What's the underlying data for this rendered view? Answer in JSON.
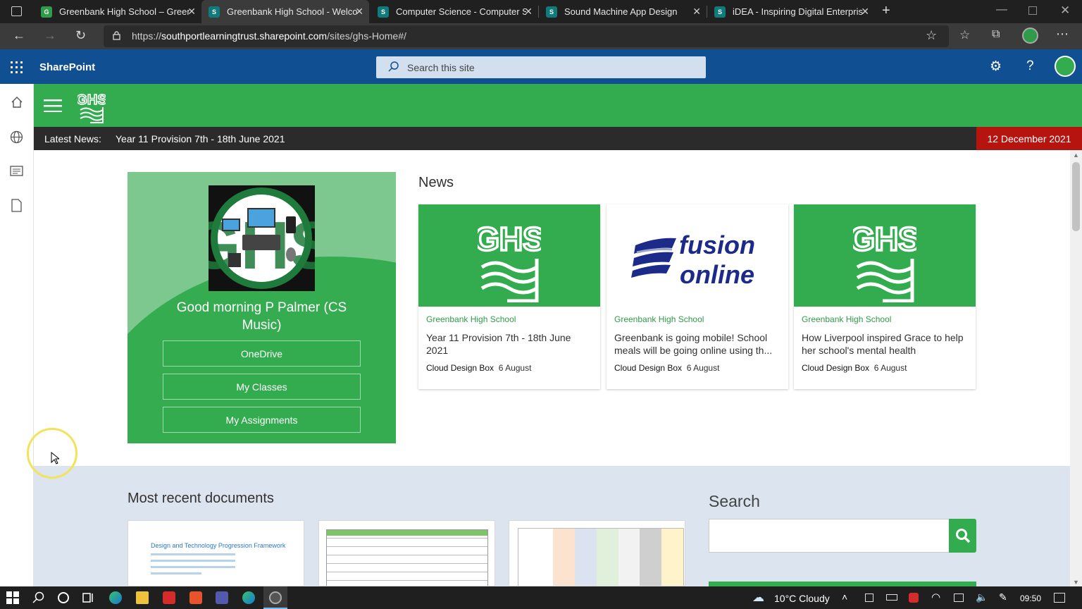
{
  "browser": {
    "tabs": [
      {
        "title": "Greenbank High School – Greenbank",
        "fav_color": "#2f9c4a",
        "fav_text": "G"
      },
      {
        "title": "Greenbank High School - Welcome",
        "fav_color": "#0f7b7b",
        "fav_text": "S"
      },
      {
        "title": "Computer Science - Computer Science",
        "fav_color": "#0f7b7b",
        "fav_text": "S"
      },
      {
        "title": "Sound Machine App Design",
        "fav_color": "#0f7b7b",
        "fav_text": "S"
      },
      {
        "title": "iDEA - Inspiring Digital Enterprise",
        "fav_color": "#0f7b7b",
        "fav_text": "S"
      }
    ],
    "active_tab": 1,
    "url_prefix": "https://",
    "url_host": "southportlearningtrust.sharepoint.com",
    "url_path": "/sites/ghs-Home#/"
  },
  "suite": {
    "app_name": "SharePoint",
    "search_placeholder": "Search this site"
  },
  "site": {
    "latest_news_label": "Latest News:",
    "latest_news_item": "Year 11 Provision 7th - 18th June 2021",
    "date": "12 December 2021"
  },
  "welcome": {
    "greeting": "Good morning P Palmer (CS Music)",
    "buttons": [
      "OneDrive",
      "My Classes",
      "My Assignments"
    ]
  },
  "news": {
    "title": "News",
    "cards": [
      {
        "source": "Greenbank High School",
        "headline": "Year 11 Provision 7th - 18th June 2021",
        "author": "Cloud Design Box",
        "date": "6 August",
        "image": "ghs-logo"
      },
      {
        "source": "Greenbank High School",
        "headline": "Greenbank is going mobile! School meals will be going online using th...",
        "author": "Cloud Design Box",
        "date": "6 August",
        "image": "fusion-online-logo"
      },
      {
        "source": "Greenbank High School",
        "headline": "How Liverpool inspired Grace to help her school's mental health",
        "author": "Cloud Design Box",
        "date": "6 August",
        "image": "ghs-logo"
      }
    ],
    "fusion_word1": "fusion",
    "fusion_word2": "online"
  },
  "documents": {
    "title": "Most recent documents",
    "doc1_title": "Design and Technology Progression Framework"
  },
  "search_panel": {
    "title": "Search"
  },
  "taskbar": {
    "weather": "10°C  Cloudy",
    "time": "09:50"
  },
  "colors": {
    "sharepoint_blue": "#0f4f92",
    "school_green": "#33ab4f",
    "date_red": "#b5140f"
  }
}
